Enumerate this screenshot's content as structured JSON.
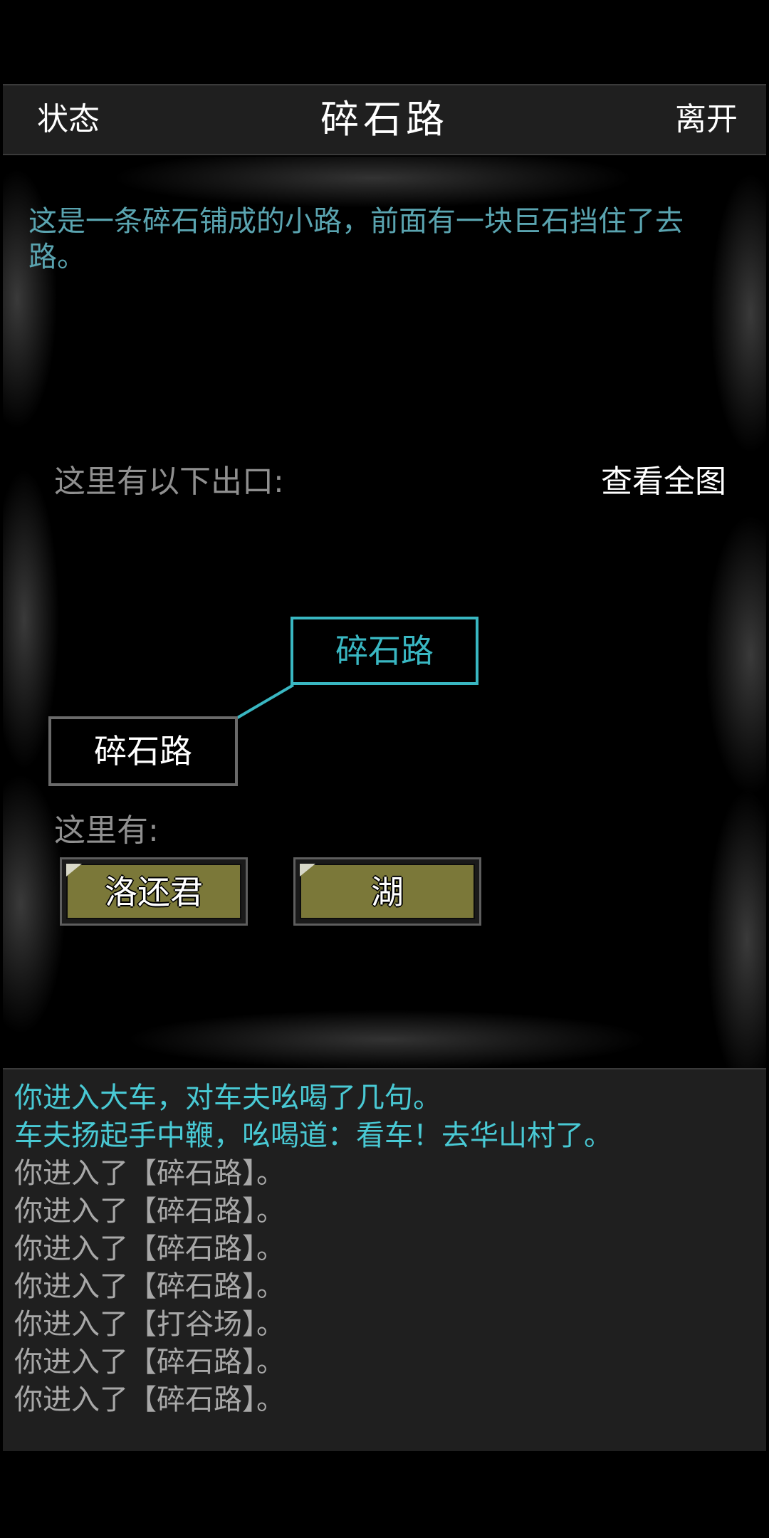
{
  "header": {
    "status_label": "状态",
    "title": "碎石路",
    "leave_label": "离开"
  },
  "scene": {
    "description": "这是一条碎石铺成的小路，前面有一块巨石挡住了去路。",
    "exits_label": "这里有以下出口:",
    "view_map_label": "查看全图",
    "current_room": "碎石路",
    "exit_room": "碎石路",
    "here_label": "这里有:",
    "entities": [
      "洛还君",
      "湖"
    ]
  },
  "log": [
    {
      "text": "你进入大车，对车夫吆喝了几句。",
      "highlight": true
    },
    {
      "text": "车夫扬起手中鞭，吆喝道：看车！去华山村了。",
      "highlight": true
    },
    {
      "text": "你进入了【碎石路】。",
      "highlight": false
    },
    {
      "text": "你进入了【碎石路】。",
      "highlight": false
    },
    {
      "text": "你进入了【碎石路】。",
      "highlight": false
    },
    {
      "text": "你进入了【碎石路】。",
      "highlight": false
    },
    {
      "text": "你进入了【打谷场】。",
      "highlight": false
    },
    {
      "text": "你进入了【碎石路】。",
      "highlight": false
    },
    {
      "text": "你进入了【碎石路】。",
      "highlight": false
    }
  ],
  "colors": {
    "accent_cyan": "#39b7c2",
    "description_text": "#5aa4b0",
    "entity_button": "#7b7839",
    "log_highlight": "#49c9d4",
    "log_normal": "#a8a8a8"
  }
}
